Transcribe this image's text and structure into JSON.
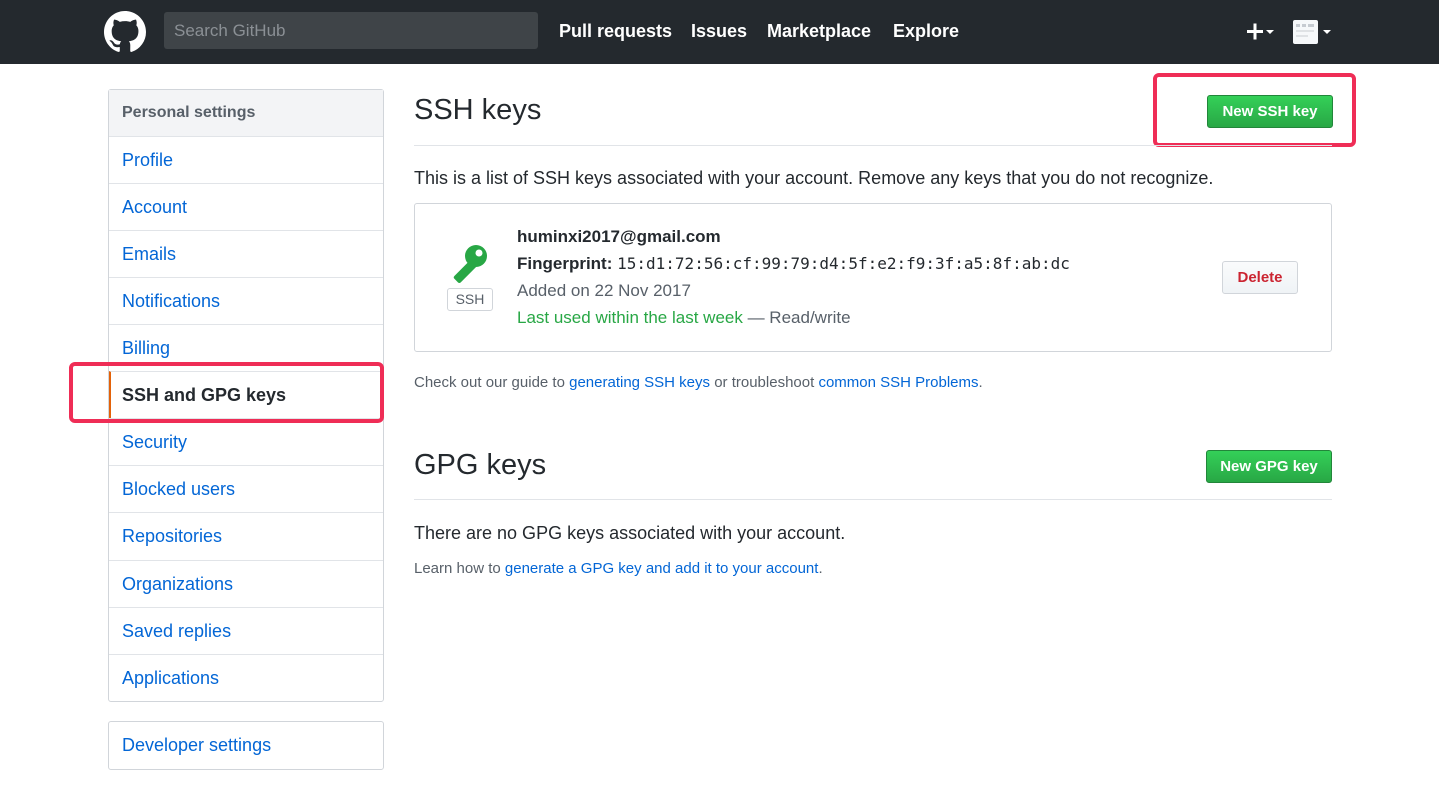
{
  "header": {
    "search_placeholder": "Search GitHub",
    "nav": [
      "Pull requests",
      "Issues",
      "Marketplace",
      "Explore"
    ],
    "plus_icon": "plus-icon",
    "avatar_icon": "avatar"
  },
  "sidebar": {
    "header": "Personal settings",
    "items": [
      {
        "label": "Profile"
      },
      {
        "label": "Account"
      },
      {
        "label": "Emails"
      },
      {
        "label": "Notifications"
      },
      {
        "label": "Billing"
      },
      {
        "label": "SSH and GPG keys",
        "selected": true
      },
      {
        "label": "Security"
      },
      {
        "label": "Blocked users"
      },
      {
        "label": "Repositories"
      },
      {
        "label": "Organizations"
      },
      {
        "label": "Saved replies"
      },
      {
        "label": "Applications"
      }
    ],
    "developer_settings": "Developer settings"
  },
  "ssh": {
    "title": "SSH keys",
    "new_button": "New SSH key",
    "description": "This is a list of SSH keys associated with your account. Remove any keys that you do not recognize.",
    "key": {
      "badge": "SSH",
      "email": "huminxi2017@gmail.com",
      "fingerprint_label": "Fingerprint:",
      "fingerprint": "15:d1:72:56:cf:99:79:d4:5f:e2:f9:3f:a5:8f:ab:dc",
      "added": "Added on 22 Nov 2017",
      "last_used": "Last used within the last week",
      "access": " — Read/write",
      "delete_button": "Delete"
    },
    "guide_prefix": "Check out our guide to ",
    "guide_link1": "generating SSH keys",
    "guide_mid": " or troubleshoot ",
    "guide_link2": "common SSH Problems",
    "guide_suffix": "."
  },
  "gpg": {
    "title": "GPG keys",
    "new_button": "New GPG key",
    "empty": "There are no GPG keys associated with your account.",
    "learn_prefix": "Learn how to ",
    "learn_link": "generate a GPG key and add it to your account",
    "learn_suffix": "."
  },
  "colors": {
    "header_bg": "#24292e",
    "link": "#0366d6",
    "green": "#28a745",
    "highlight": "#ef2d56",
    "danger": "#cb2431"
  }
}
